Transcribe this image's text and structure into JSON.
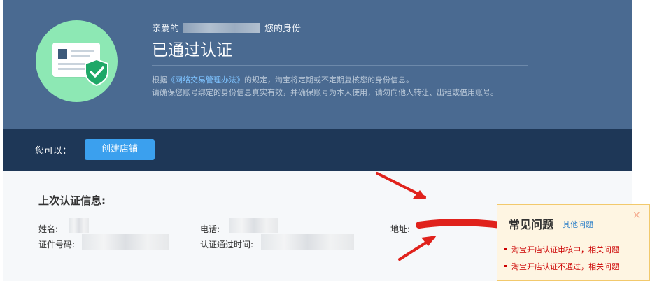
{
  "hero": {
    "greeting_prefix": "亲爱的",
    "greeting_suffix": "您的身份",
    "title": "已通过认证",
    "desc1_prefix": "根据",
    "desc1_link": "《网络交易管理办法》",
    "desc1_suffix": "的规定，淘宝将定期或不定期复核您的身份信息。",
    "desc2": "请确保您账号绑定的身份信息真实有效，并确保账号为本人使用，请勿向他人转让、出租或借用账号。"
  },
  "actions": {
    "can_label": "您可以：",
    "create_store_button": "创建店铺"
  },
  "last_cert": {
    "title": "上次认证信息:",
    "name_label": "姓名:",
    "phone_label": "电话:",
    "address_label": "地址:",
    "id_label": "证件号码:",
    "time_label": "认证通过时间:"
  },
  "faq": {
    "title": "常见问题",
    "other_link": "其他问题",
    "close": "×",
    "items": [
      "淘宝开店认证审核中，相关问题",
      "淘宝开店认证不通过，相关问题"
    ]
  },
  "colors": {
    "hero_bg": "#4a6a91",
    "action_bar_bg": "#1e3757",
    "button_bg": "#3ba0ee",
    "badge_green": "#8de8b4",
    "faq_bg": "#fef5e2",
    "faq_link_red": "#cc0000",
    "annotation_red": "#e0221c"
  }
}
